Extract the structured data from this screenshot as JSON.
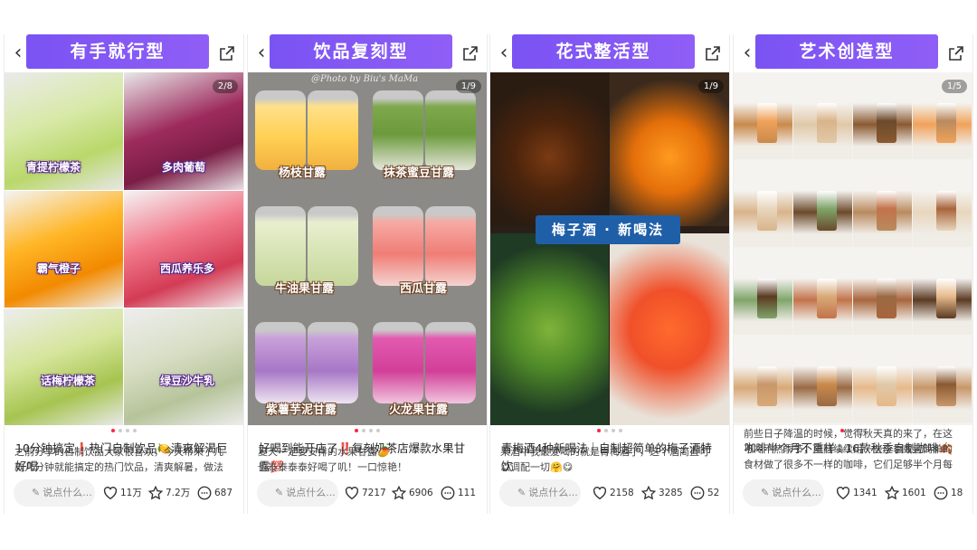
{
  "cards": [
    {
      "category": "有手就行型",
      "counter": "2/8",
      "labels": [
        "青提柠檬茶",
        "多肉葡萄",
        "霸气橙子",
        "西瓜养乐多",
        "话梅柠檬茶",
        "绿豆沙牛乳"
      ],
      "title": "10分钟搞定❗热门自制饮品🍋清爽解渴巨好喝",
      "desc": "之前分享的自制饮品大家很喜欢，今天带来了几款几分钟就能搞定的热门饮品，清爽解暑，做法",
      "comment_placeholder": "说点什么...",
      "likes": "11万",
      "stars": "7.2万",
      "comments": "687"
    },
    {
      "category": "饮品复刻型",
      "counter": "1/9",
      "photo_credit": "@Photo by Biu's MaMa",
      "labels": [
        "杨枝甘露",
        "抹茶蜜豆甘露",
        "牛油果甘露",
        "西瓜甘露",
        "紫薯芋泥甘露",
        "火龙果甘露"
      ],
      "title": "好喝到能开店了‼️复刻奶茶店爆款水果甘露💯",
      "desc": "夏天一定要安排的水果甘露🥭\n也泰泰泰泰好喝了叽！一口惊艳！",
      "comment_placeholder": "说点什么...",
      "likes": "7217",
      "stars": "6906",
      "comments": "111"
    },
    {
      "category": "花式整活型",
      "counter": "1/9",
      "banner": "梅子酒 · 新喝法",
      "title": "青梅酒4种新喝法｜自制超简单的梅子酒特饮",
      "desc": "果酒中我最爱喝的就是青梅酒了，这个酒简直可以调配一切🤗😋",
      "comment_placeholder": "说点什么...",
      "likes": "2158",
      "stars": "3285",
      "comments": "52"
    },
    {
      "category": "艺术创造型",
      "counter": "1/5",
      "title": "咖啡半个月不重样☕16款秋季自制咖啡🍂",
      "desc": "前些日子降温的时候，觉得秋天真的来了，在这不冷不热季节，陆陆续续用一些应季或者简单的食材做了很多不一样的咖啡，它们足够半个月每",
      "comment_placeholder": "说点什么...",
      "likes": "1341",
      "stars": "1601",
      "comments": "18"
    }
  ],
  "icons": {
    "back": "chevron-left-icon",
    "share": "share-external-icon",
    "like": "heart-icon",
    "star": "star-icon",
    "comment": "comment-bubble-icon",
    "pen": "pencil-icon"
  },
  "colors": {
    "pill": "#7a53f3",
    "dot_active": "#ff2442"
  }
}
